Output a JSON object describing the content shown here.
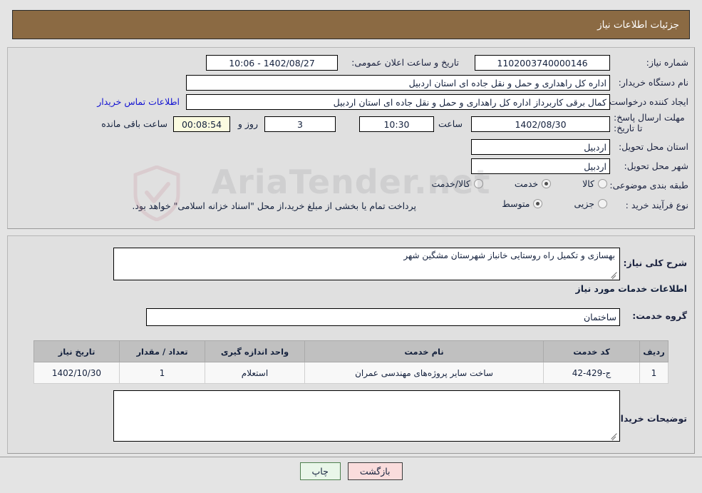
{
  "header": {
    "title": "جزئیات اطلاعات نیاز"
  },
  "form": {
    "need_number_label": "شماره نیاز:",
    "need_number_value": "1102003740000146",
    "announce_label": "تاریخ و ساعت اعلان عمومی:",
    "announce_value": "1402/08/27 - 10:06",
    "buyer_org_label": "نام دستگاه خریدار:",
    "buyer_org_value": "اداره کل راهداری و حمل و نقل جاده ای استان اردبیل",
    "requester_label": "ایجاد کننده درخواست:",
    "requester_value": "کمال برقی کاربرداز اداره کل راهداری و حمل و نقل جاده ای استان اردبیل",
    "contact_link": "اطلاعات تماس خریدار",
    "deadline_label": "مهلت ارسال پاسخ: تا تاریخ:",
    "deadline_date": "1402/08/30",
    "hour_label": "ساعت",
    "deadline_time": "10:30",
    "days_value": "3",
    "days_label": "روز و",
    "countdown_value": "00:08:54",
    "remaining_label": "ساعت باقی مانده",
    "province_label": "استان محل تحویل:",
    "province_value": "اردبیل",
    "city_label": "شهر محل تحویل:",
    "city_value": "اردبیل",
    "category_label": "طبقه بندی موضوعی:",
    "category_options": [
      {
        "label": "کالا",
        "selected": false
      },
      {
        "label": "خدمت",
        "selected": true
      },
      {
        "label": "کالا/خدمت",
        "selected": false
      }
    ],
    "process_label": "نوع فرآیند خرید :",
    "process_options": [
      {
        "label": "جزیی",
        "selected": false
      },
      {
        "label": "متوسط",
        "selected": true
      }
    ],
    "treasury_note": "پرداخت تمام یا بخشی از مبلغ خرید،از محل \"اسناد خزانه اسلامی\" خواهد بود."
  },
  "description": {
    "label": "شرح کلی نیاز:",
    "value": "بهسازی و تکمیل راه روستایی خانباز شهرستان مشگین شهر"
  },
  "services_section": {
    "heading": "اطلاعات خدمات مورد نیاز",
    "group_label": "گروه خدمت:",
    "group_value": "ساختمان"
  },
  "table": {
    "columns": [
      "ردیف",
      "کد خدمت",
      "نام خدمت",
      "واحد اندازه گیری",
      "تعداد / مقدار",
      "تاریخ نیاز"
    ],
    "rows": [
      {
        "index": "1",
        "code": "ج-429-42",
        "name": "ساخت سایر پروژه‌های مهندسی عمران",
        "unit": "استعلام",
        "qty": "1",
        "date": "1402/10/30"
      }
    ]
  },
  "buyer_notes": {
    "label": "توضیحات خریدار:",
    "value": ""
  },
  "buttons": {
    "back": "بازگشت",
    "print": "چاپ"
  },
  "watermark": {
    "text": "AriaTender.net"
  },
  "colors": {
    "header_bg": "#8b6a43",
    "panel_bg": "#e0e0e0",
    "link": "#1414d2",
    "back_btn": "#fadcdc",
    "print_btn": "#e9f6e9",
    "table_header": "#c0c0c0"
  }
}
